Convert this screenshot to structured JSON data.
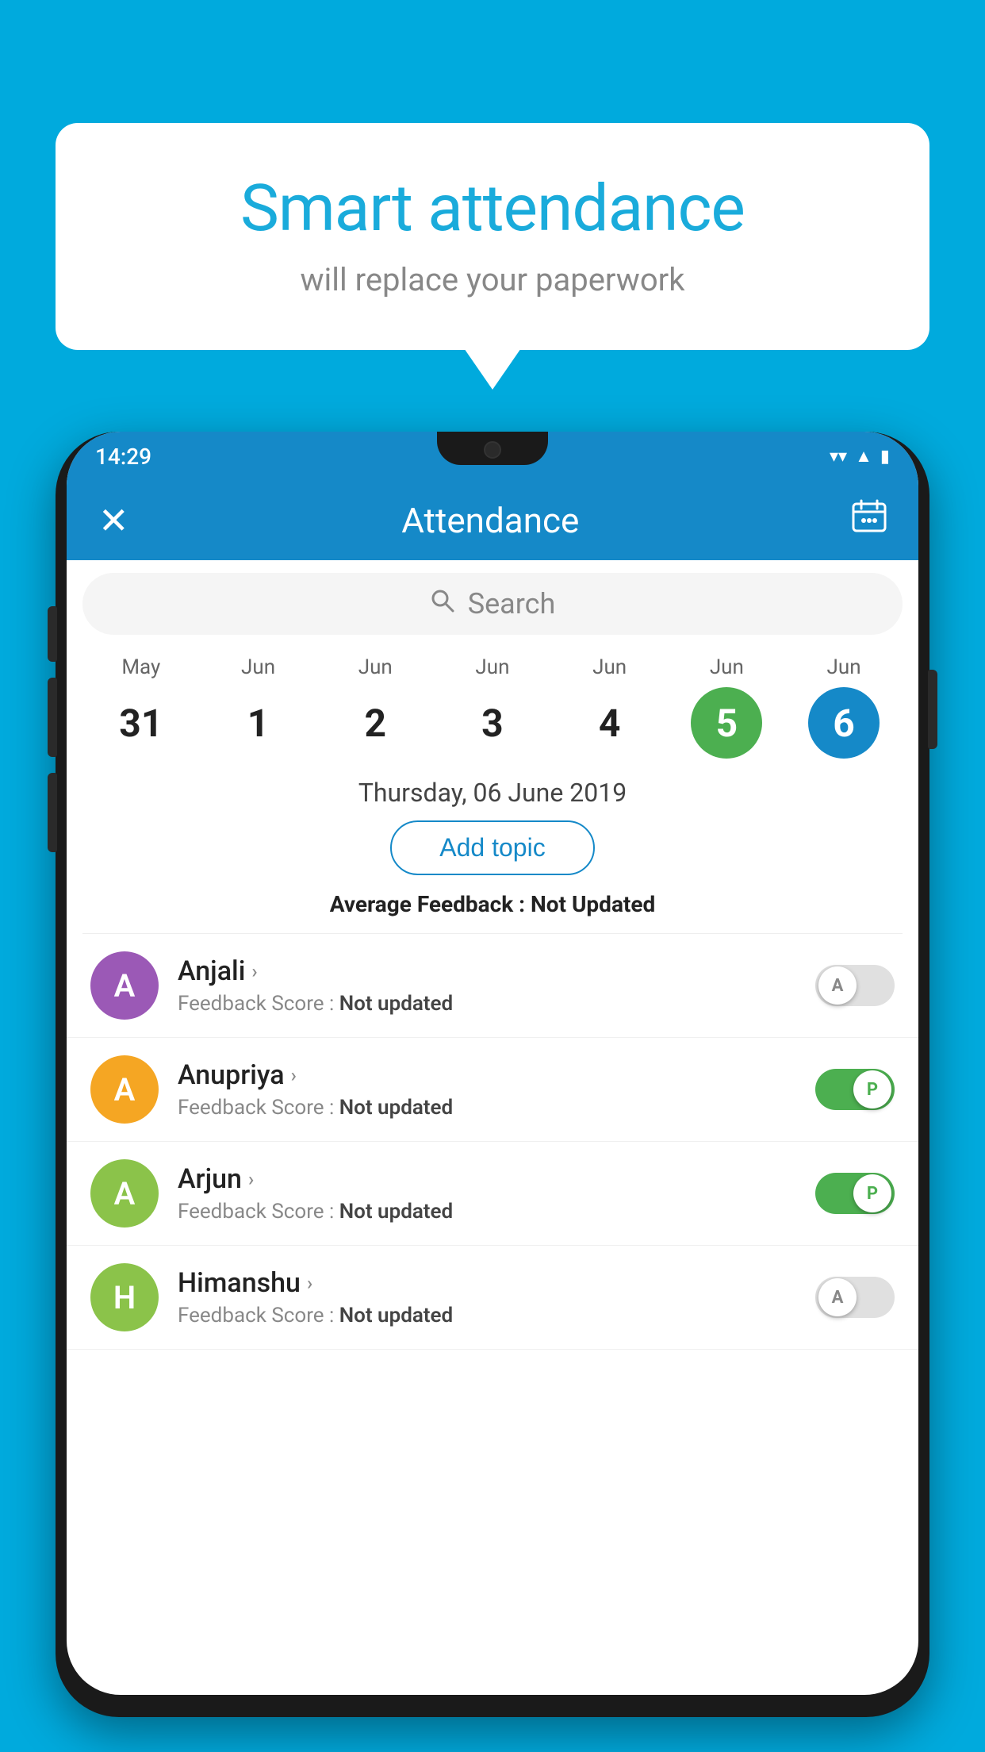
{
  "background_color": "#00AADD",
  "speech_bubble": {
    "title": "Smart attendance",
    "subtitle": "will replace your paperwork"
  },
  "status_bar": {
    "time": "14:29",
    "wifi": "wifi",
    "signal": "signal",
    "battery": "battery"
  },
  "app_bar": {
    "close_label": "✕",
    "title": "Attendance",
    "calendar_icon": "📅"
  },
  "search": {
    "placeholder": "Search"
  },
  "calendar": {
    "days": [
      {
        "month": "May",
        "date": "31",
        "style": "normal"
      },
      {
        "month": "Jun",
        "date": "1",
        "style": "normal"
      },
      {
        "month": "Jun",
        "date": "2",
        "style": "normal"
      },
      {
        "month": "Jun",
        "date": "3",
        "style": "normal"
      },
      {
        "month": "Jun",
        "date": "4",
        "style": "normal"
      },
      {
        "month": "Jun",
        "date": "5",
        "style": "today"
      },
      {
        "month": "Jun",
        "date": "6",
        "style": "selected"
      }
    ]
  },
  "selected_date": "Thursday, 06 June 2019",
  "add_topic_label": "Add topic",
  "avg_feedback_label": "Average Feedback :",
  "avg_feedback_value": "Not Updated",
  "students": [
    {
      "name": "Anjali",
      "initial": "A",
      "avatar_color": "#9B59B6",
      "score_label": "Feedback Score :",
      "score_value": "Not updated",
      "toggle_state": "off",
      "toggle_letter": "A"
    },
    {
      "name": "Anupriya",
      "initial": "A",
      "avatar_color": "#F5A623",
      "score_label": "Feedback Score :",
      "score_value": "Not updated",
      "toggle_state": "on",
      "toggle_letter": "P"
    },
    {
      "name": "Arjun",
      "initial": "A",
      "avatar_color": "#8BC34A",
      "score_label": "Feedback Score :",
      "score_value": "Not updated",
      "toggle_state": "on",
      "toggle_letter": "P"
    },
    {
      "name": "Himanshu",
      "initial": "H",
      "avatar_color": "#8BC34A",
      "score_label": "Feedback Score :",
      "score_value": "Not updated",
      "toggle_state": "off",
      "toggle_letter": "A"
    }
  ]
}
